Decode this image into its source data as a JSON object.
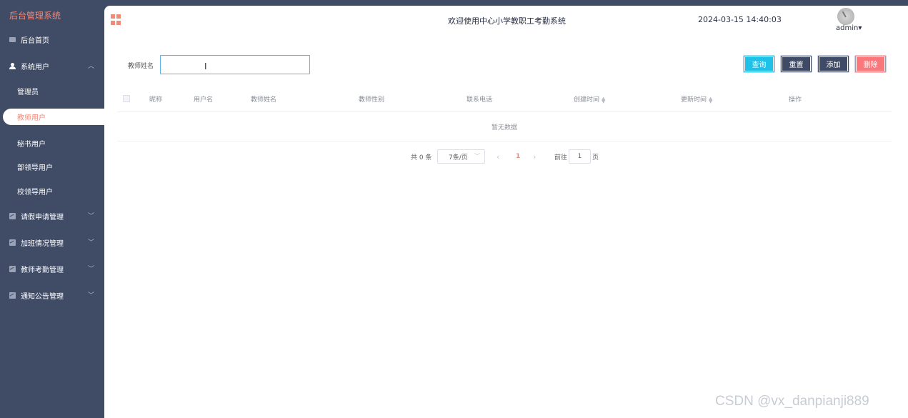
{
  "sidebar": {
    "brand": "后台管理系统",
    "home": "后台首页",
    "system_users": "系统用户",
    "sub_items": [
      "管理员",
      "教师用户",
      "秘书用户",
      "部领导用户",
      "校领导用户"
    ],
    "groups": [
      "请假申请管理",
      "加班情况管理",
      "教师考勤管理",
      "通知公告管理"
    ]
  },
  "header": {
    "welcome": "欢迎使用中心小学教职工考勤系统",
    "datetime": "2024-03-15 14:40:03",
    "username": "admin",
    "caret": "▾"
  },
  "search": {
    "label": "教师姓名",
    "value": "",
    "placeholder": ""
  },
  "buttons": {
    "query": "查询",
    "reset": "重置",
    "add": "添加",
    "delete": "删除"
  },
  "table": {
    "columns": [
      "昵称",
      "用户名",
      "教师姓名",
      "教师性别",
      "联系电话",
      "创建时间",
      "更新时间",
      "操作"
    ],
    "empty_text": "暂无数据"
  },
  "pagination": {
    "total": "共 0 条",
    "page_size": "7条/页",
    "current": "1",
    "goto_label": "前往",
    "goto_value": "1",
    "page_unit": "页"
  },
  "watermark": "CSDN @vx_danpianji889",
  "colors": {
    "sidebar_bg": "#404c66",
    "accent": "#f08a79",
    "query_btn": "#20c1e8",
    "dark_btn": "#3f4b66",
    "delete_btn": "#f9787b"
  }
}
